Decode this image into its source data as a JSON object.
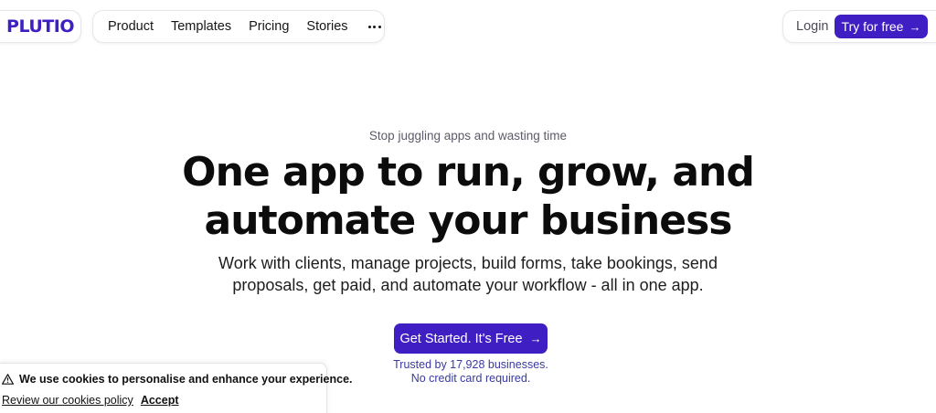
{
  "header": {
    "logo_text": "PLUTIO",
    "nav": [
      {
        "label": "Product"
      },
      {
        "label": "Templates"
      },
      {
        "label": "Pricing"
      },
      {
        "label": "Stories"
      }
    ],
    "more_icon": "ellipsis-icon",
    "login_label": "Login",
    "try_label": "Try for free",
    "arrow_icon": "arrow-right-icon"
  },
  "hero": {
    "tagline": "Stop juggling apps and wasting time",
    "headline_line1": "One app to run, grow, and",
    "headline_line2": "automate your business",
    "subtext_line1": "Work with clients, manage projects, build forms, take bookings, send",
    "subtext_line2": "proposals, get paid, and automate your workflow - all in one app.",
    "cta_label": "Get Started. It's Free",
    "trust_line1": "Trusted by 17,928 businesses.",
    "trust_line2": "No credit card required."
  },
  "cookie_banner": {
    "icon": "warning-icon",
    "message": "We use cookies to personalise and enhance your experience.",
    "policy_link": "Review our cookies policy",
    "accept_label": "Accept"
  },
  "colors": {
    "brand": "#3f1fc4",
    "trust_text": "#3a3aa0",
    "tagline_text": "#5b5b69"
  }
}
